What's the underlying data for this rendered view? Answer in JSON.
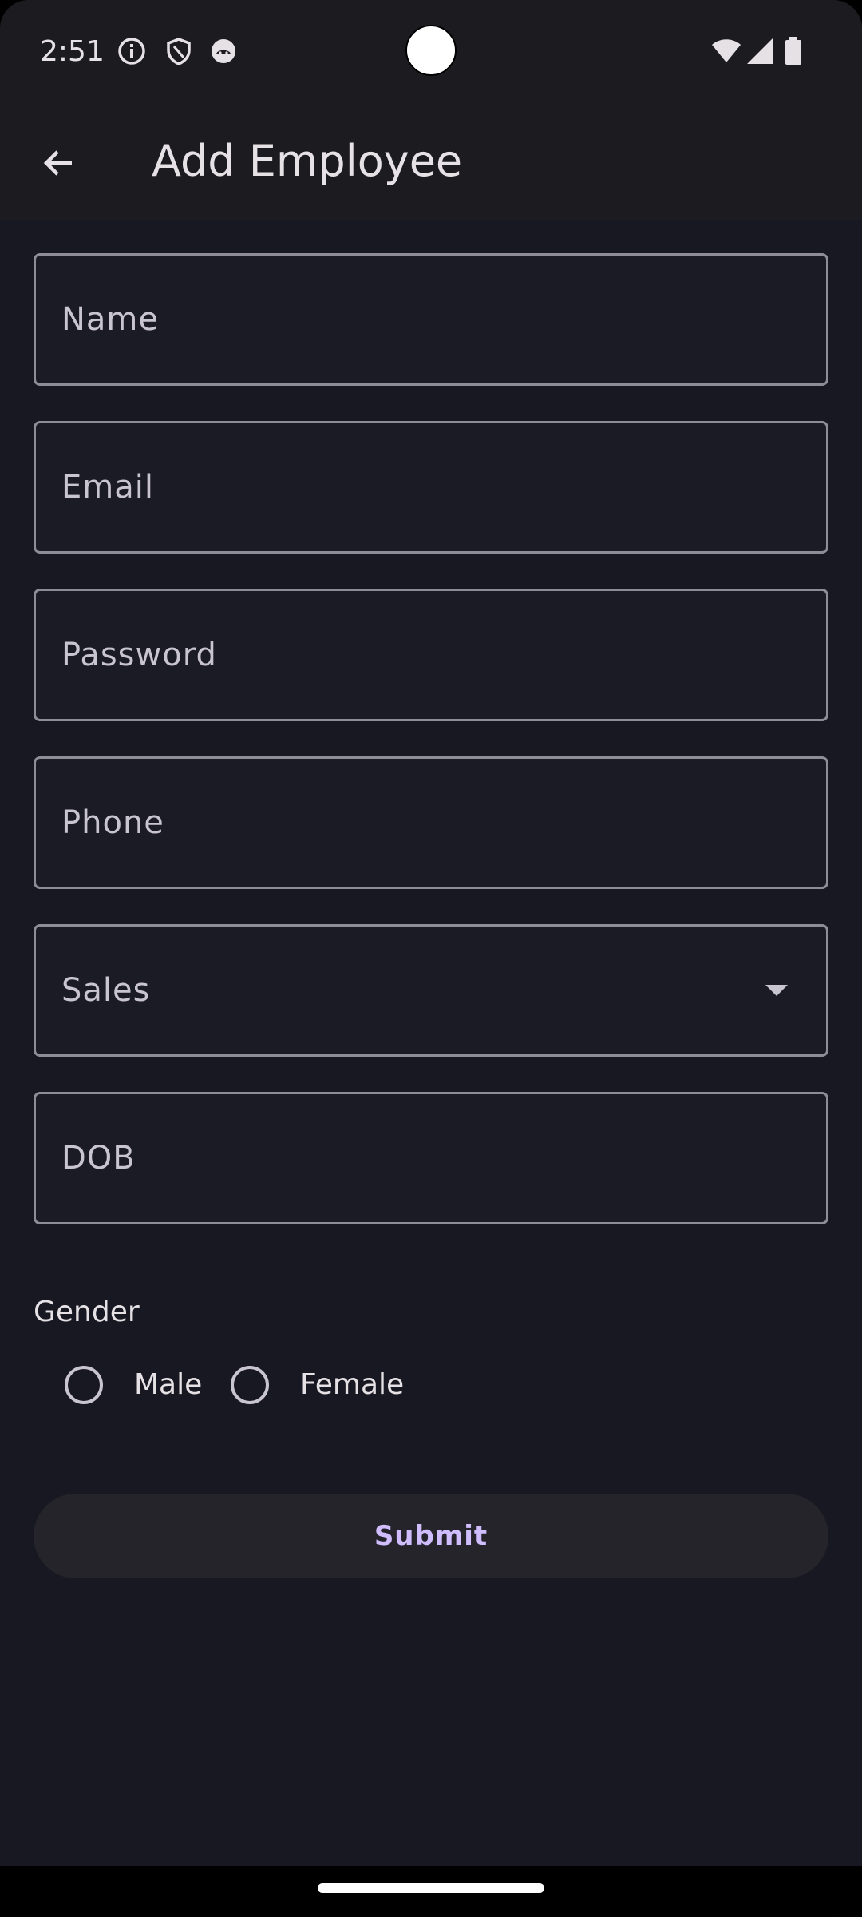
{
  "status_bar": {
    "time": "2:51",
    "left_icons": [
      "info-icon",
      "shield-icon",
      "android-icon"
    ],
    "right_icons": [
      "wifi-icon",
      "signal-icon",
      "battery-icon"
    ]
  },
  "app_bar": {
    "back_icon": "arrow-back-icon",
    "title": "Add Employee"
  },
  "form": {
    "name_placeholder": "Name",
    "email_placeholder": "Email",
    "password_placeholder": "Password",
    "phone_placeholder": "Phone",
    "department_selected": "Sales",
    "dob_placeholder": "DOB",
    "gender_label": "Gender",
    "gender_options": [
      {
        "label": "Male",
        "selected": false
      },
      {
        "label": "Female",
        "selected": false
      }
    ],
    "submit_label": "Submit"
  },
  "colors": {
    "background": "#181822",
    "app_bar": "#1c1b20",
    "outline": "#8e8c96",
    "accent": "#cfbdfe"
  }
}
